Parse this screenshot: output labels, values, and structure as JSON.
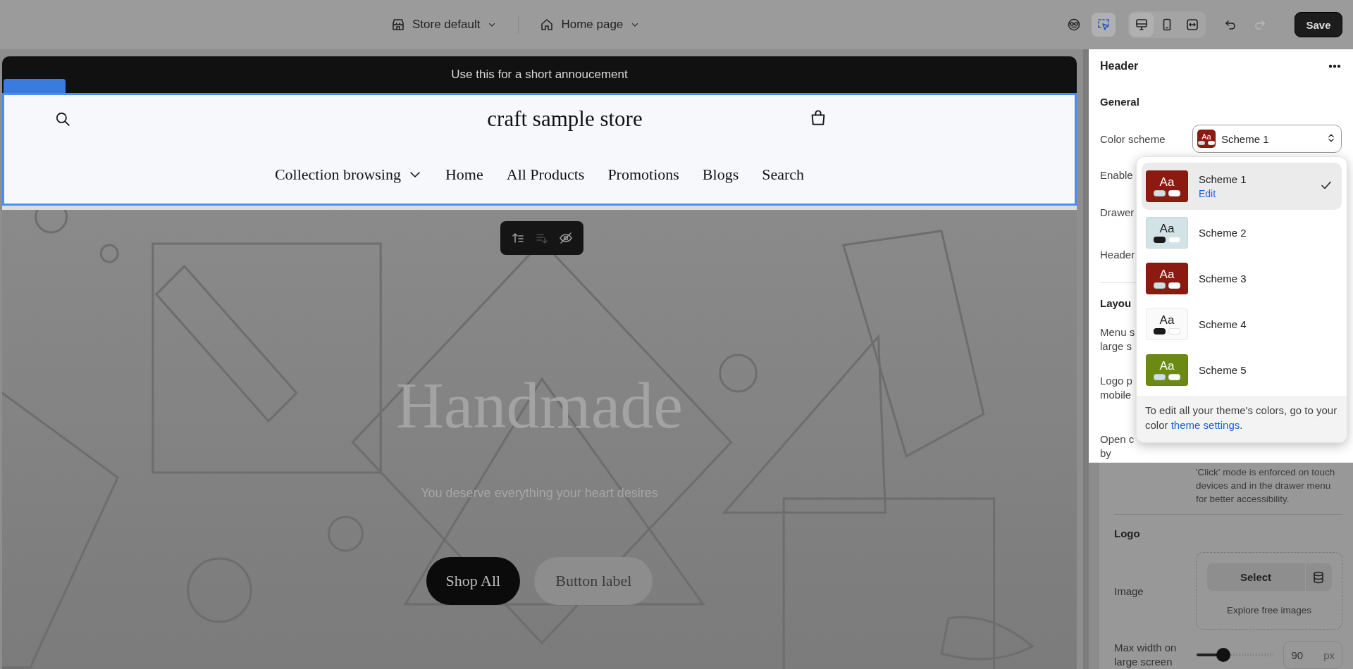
{
  "topbar": {
    "theme": "Store default",
    "page": "Home page",
    "tools": [
      {
        "kind": "inspector",
        "selected": false
      },
      {
        "kind": "select",
        "selected": true
      }
    ],
    "views": [
      {
        "kind": "desktop",
        "selected": true
      },
      {
        "kind": "mobile",
        "selected": false
      },
      {
        "kind": "fullwidth",
        "selected": false
      }
    ],
    "history": [
      {
        "kind": "undo",
        "disabled": false
      },
      {
        "kind": "redo",
        "disabled": true
      }
    ],
    "save": "Save"
  },
  "preview": {
    "announcement": "Use this for a short annoucement",
    "header": {
      "store_name": "craft sample store",
      "nav": [
        {
          "label": "Collection browsing",
          "kind": "dropdown"
        },
        {
          "label": "Home",
          "kind": "link"
        },
        {
          "label": "All Products",
          "kind": "link"
        },
        {
          "label": "Promotions",
          "kind": "link"
        },
        {
          "label": "Blogs",
          "kind": "link"
        },
        {
          "label": "Search",
          "kind": "link"
        }
      ]
    },
    "section_tools": [
      {
        "kind": "move_up",
        "disabled": false
      },
      {
        "kind": "move_down",
        "disabled": true
      },
      {
        "kind": "hide",
        "disabled": false
      }
    ],
    "hero": {
      "title": "Handmade",
      "subtitle": "You deserve everything your heart desires",
      "buttons": [
        {
          "label": "Shop All",
          "kind": "primary"
        },
        {
          "label": "Button label",
          "kind": "secondary"
        }
      ]
    }
  },
  "panel": {
    "title": "Header",
    "section": "General",
    "color_scheme_label": "Color scheme",
    "color_scheme_value": "Scheme 1",
    "color_scheme_swatch": {
      "aa": "Aa",
      "color": "#8b1a10"
    },
    "hidden_labels": [
      [
        "Enable"
      ],
      [
        "Drawer"
      ],
      [
        "Header"
      ]
    ],
    "layout_heading": "Layou",
    "layout_labels": [
      [
        "Menu s",
        "large s"
      ],
      [
        "Logo p",
        "mobile"
      ],
      [
        "Open c",
        "by"
      ]
    ],
    "helper": "'Click' mode is enforced on touch devices and in the drawer menu for better accessibility.",
    "logo_heading": "Logo",
    "image_label": "Image",
    "select_button": "Select",
    "explore": "Explore free images",
    "max_width_label": "Max width on large screen",
    "max_width": {
      "level": 0.34,
      "value": "90",
      "unit": "px"
    }
  },
  "scheme_popup": {
    "schemes": [
      {
        "name": "Scheme 1",
        "selected": true,
        "edit": "Edit",
        "aa": "Aa",
        "color": "#8b1a10"
      },
      {
        "name": "Scheme 2",
        "selected": false,
        "aa": "Aa",
        "color": "#d2e3e7"
      },
      {
        "name": "Scheme 3",
        "selected": false,
        "aa": "Aa",
        "color": "#8b1a10"
      },
      {
        "name": "Scheme 4",
        "selected": false,
        "aa": "Aa",
        "color": "#fafafa"
      },
      {
        "name": "Scheme 5",
        "selected": false,
        "aa": "Aa",
        "color": "#6a8a14"
      }
    ],
    "footer": "To edit all your theme's colors, go to your color ",
    "footer_link": "theme settings",
    "footer_end": "."
  }
}
